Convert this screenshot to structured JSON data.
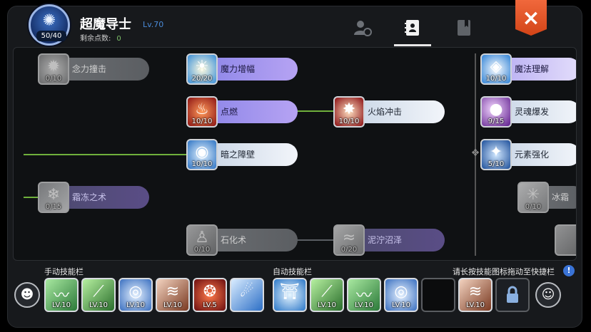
{
  "header": {
    "class_name": "超魔导士",
    "class_level": "Lv.70",
    "points_badge": "50/40",
    "remaining_label": "剩余点数:",
    "remaining_value": "0",
    "close_symbol": "×"
  },
  "colors": {
    "accent_orange": "#e3552a",
    "green_link": "#6fb03c",
    "level_blue": "#4a8bd8"
  },
  "tabs": [
    {
      "icon": "user-settings-icon",
      "active": false
    },
    {
      "icon": "contact-book-icon",
      "active": true
    },
    {
      "icon": "bookmark-book-icon",
      "active": false
    }
  ],
  "skills": {
    "nianli_chongji": {
      "name": "念力撞击",
      "level": "0/10",
      "icon": "burst-icon"
    },
    "moli_zengfu": {
      "name": "魔力增幅",
      "level": "20/20",
      "icon": "sun-icon"
    },
    "dianran": {
      "name": "点燃",
      "level": "10/10",
      "icon": "flame-icon"
    },
    "huoyan_chongji": {
      "name": "火焰冲击",
      "level": "10/10",
      "icon": "fire-blast-icon"
    },
    "anzhi_zhangbi": {
      "name": "暗之障壁",
      "level": "10/10",
      "icon": "eye-shield-icon"
    },
    "shuangdong_zhishu": {
      "name": "霜冻之术",
      "level": "0/15",
      "icon": "frost-icon"
    },
    "shihua_shu": {
      "name": "石化术",
      "level": "0/10",
      "icon": "stone-figure-icon"
    },
    "niqu_zhaoze": {
      "name": "泥泞沼泽",
      "level": "0/20",
      "icon": "swamp-icon"
    },
    "mofa_lijie": {
      "name": "魔法理解",
      "level": "10/10",
      "icon": "crystal-icon"
    },
    "linghun_baofa": {
      "name": "灵魂爆发",
      "level": "9/15",
      "icon": "soul-orb-icon"
    },
    "yuansu_qianghua": {
      "name": "元素强化",
      "level": "5/10",
      "icon": "element-star-icon"
    },
    "partial": {
      "name": "冰霜",
      "level": "0/10",
      "icon": "snow-burst-icon"
    }
  },
  "quickbar": {
    "manual_label": "手动技能栏",
    "auto_label": "自动技能栏",
    "hint": "请长按技能图标拖动至快捷栏",
    "info_symbol": "!",
    "manual_slots": [
      {
        "lv": "LV.10",
        "icon": "green-wave-icon"
      },
      {
        "lv": "LV.10",
        "icon": "green-slash-icon"
      },
      {
        "lv": "LV.10",
        "icon": "blue-vortex-icon"
      },
      {
        "lv": "LV.10",
        "icon": "tornado-icon"
      },
      {
        "lv": "LV.5",
        "icon": "red-orbs-icon"
      },
      {
        "lv": "",
        "icon": "blue-comet-icon"
      }
    ],
    "auto_slots": [
      {
        "lv": "",
        "icon": "blue-sigil-icon"
      },
      {
        "lv": "LV.10",
        "icon": "green-slash-icon"
      },
      {
        "lv": "LV.10",
        "icon": "green-wave-icon"
      },
      {
        "lv": "LV.10",
        "icon": "blue-vortex-icon"
      },
      {
        "lv": "",
        "icon": "empty-slot"
      },
      {
        "lv": "LV.10",
        "icon": "tornado-icon"
      },
      {
        "lv": "",
        "icon": "lock-icon"
      }
    ]
  }
}
